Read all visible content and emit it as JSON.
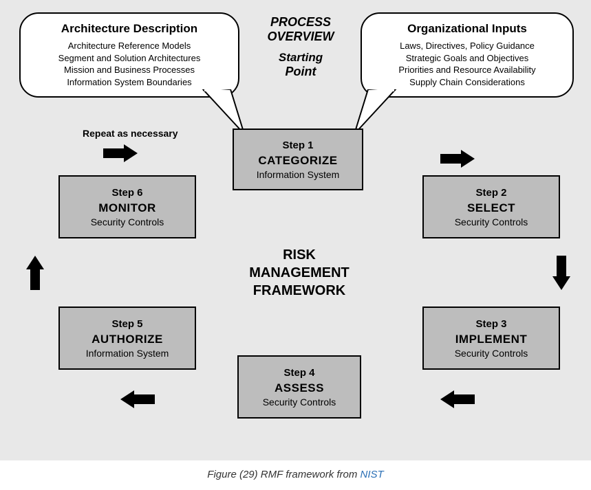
{
  "overview": {
    "line1": "PROCESS",
    "line2": "OVERVIEW",
    "sp1": "Starting",
    "sp2": "Point"
  },
  "arch": {
    "title": "Architecture Description",
    "l1": "Architecture Reference Models",
    "l2": "Segment and Solution Architectures",
    "l3": "Mission and Business Processes",
    "l4": "Information System Boundaries"
  },
  "org": {
    "title": "Organizational Inputs",
    "l1": "Laws, Directives, Policy Guidance",
    "l2": "Strategic Goals and Objectives",
    "l3": "Priorities and Resource Availability",
    "l4": "Supply Chain Considerations"
  },
  "repeat": "Repeat as necessary",
  "center": {
    "l1": "RISK",
    "l2": "MANAGEMENT",
    "l3": "FRAMEWORK"
  },
  "steps": {
    "s1": {
      "num": "Step 1",
      "action": "CATEGORIZE",
      "sub": "Information System"
    },
    "s2": {
      "num": "Step 2",
      "action": "SELECT",
      "sub": "Security Controls"
    },
    "s3": {
      "num": "Step 3",
      "action": "IMPLEMENT",
      "sub": "Security Controls"
    },
    "s4": {
      "num": "Step 4",
      "action": "ASSESS",
      "sub": "Security Controls"
    },
    "s5": {
      "num": "Step 5",
      "action": "AUTHORIZE",
      "sub": "Information System"
    },
    "s6": {
      "num": "Step 6",
      "action": "MONITOR",
      "sub": "Security Controls"
    }
  },
  "caption": {
    "prefix": "Figure (29) RMF framework from ",
    "link": "NIST"
  }
}
